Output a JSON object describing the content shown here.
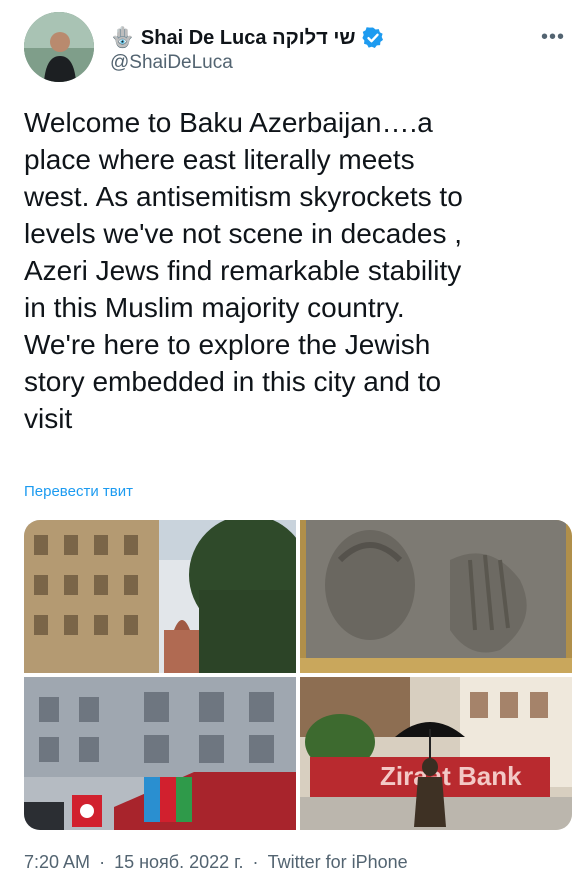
{
  "author": {
    "display_name": "Shai De Luca שי דלוקה",
    "handle": "@ShaiDeLuca",
    "name_emoji": "🪬"
  },
  "tweet": {
    "text": "Welcome to Baku Azerbaijan….a\nplace where east literally meets\nwest. As antisemitism skyrockets  to\nlevels we've not scene in decades ,\nAzeri Jews find remarkable stability\nin this Muslim majority country.\nWe're here to explore the Jewish\nstory embedded in this city and to\nvisit",
    "translate_label": "Перевести твит"
  },
  "media": {
    "bank_sign": "Ziraat Bank"
  },
  "meta": {
    "time": "7:20 AM",
    "date": "15 нояб. 2022 г.",
    "source": "Twitter for iPhone",
    "separator": "·"
  },
  "colors": {
    "link": "#1d9bf0",
    "secondary_text": "#536471",
    "verified": "#1d9bf0"
  }
}
